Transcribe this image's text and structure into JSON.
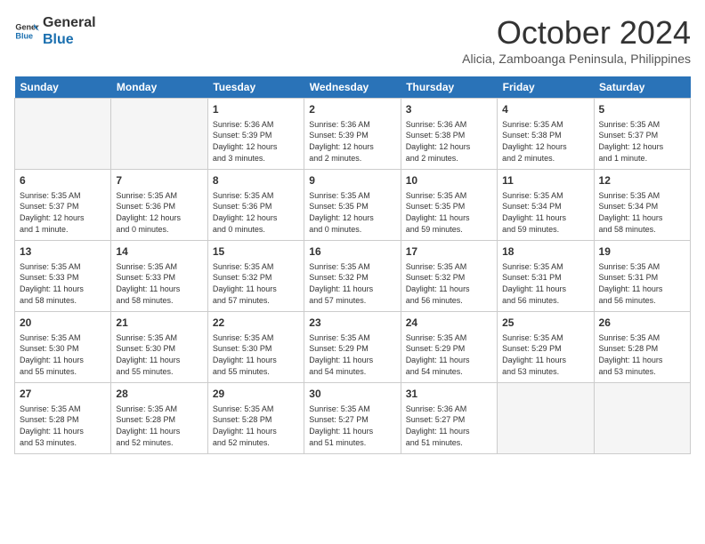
{
  "logo": {
    "line1": "General",
    "line2": "Blue"
  },
  "title": "October 2024",
  "subtitle": "Alicia, Zamboanga Peninsula, Philippines",
  "headers": [
    "Sunday",
    "Monday",
    "Tuesday",
    "Wednesday",
    "Thursday",
    "Friday",
    "Saturday"
  ],
  "weeks": [
    [
      {
        "day": "",
        "info": ""
      },
      {
        "day": "",
        "info": ""
      },
      {
        "day": "1",
        "info": "Sunrise: 5:36 AM\nSunset: 5:39 PM\nDaylight: 12 hours\nand 3 minutes."
      },
      {
        "day": "2",
        "info": "Sunrise: 5:36 AM\nSunset: 5:39 PM\nDaylight: 12 hours\nand 2 minutes."
      },
      {
        "day": "3",
        "info": "Sunrise: 5:36 AM\nSunset: 5:38 PM\nDaylight: 12 hours\nand 2 minutes."
      },
      {
        "day": "4",
        "info": "Sunrise: 5:35 AM\nSunset: 5:38 PM\nDaylight: 12 hours\nand 2 minutes."
      },
      {
        "day": "5",
        "info": "Sunrise: 5:35 AM\nSunset: 5:37 PM\nDaylight: 12 hours\nand 1 minute."
      }
    ],
    [
      {
        "day": "6",
        "info": "Sunrise: 5:35 AM\nSunset: 5:37 PM\nDaylight: 12 hours\nand 1 minute."
      },
      {
        "day": "7",
        "info": "Sunrise: 5:35 AM\nSunset: 5:36 PM\nDaylight: 12 hours\nand 0 minutes."
      },
      {
        "day": "8",
        "info": "Sunrise: 5:35 AM\nSunset: 5:36 PM\nDaylight: 12 hours\nand 0 minutes."
      },
      {
        "day": "9",
        "info": "Sunrise: 5:35 AM\nSunset: 5:35 PM\nDaylight: 12 hours\nand 0 minutes."
      },
      {
        "day": "10",
        "info": "Sunrise: 5:35 AM\nSunset: 5:35 PM\nDaylight: 11 hours\nand 59 minutes."
      },
      {
        "day": "11",
        "info": "Sunrise: 5:35 AM\nSunset: 5:34 PM\nDaylight: 11 hours\nand 59 minutes."
      },
      {
        "day": "12",
        "info": "Sunrise: 5:35 AM\nSunset: 5:34 PM\nDaylight: 11 hours\nand 58 minutes."
      }
    ],
    [
      {
        "day": "13",
        "info": "Sunrise: 5:35 AM\nSunset: 5:33 PM\nDaylight: 11 hours\nand 58 minutes."
      },
      {
        "day": "14",
        "info": "Sunrise: 5:35 AM\nSunset: 5:33 PM\nDaylight: 11 hours\nand 58 minutes."
      },
      {
        "day": "15",
        "info": "Sunrise: 5:35 AM\nSunset: 5:32 PM\nDaylight: 11 hours\nand 57 minutes."
      },
      {
        "day": "16",
        "info": "Sunrise: 5:35 AM\nSunset: 5:32 PM\nDaylight: 11 hours\nand 57 minutes."
      },
      {
        "day": "17",
        "info": "Sunrise: 5:35 AM\nSunset: 5:32 PM\nDaylight: 11 hours\nand 56 minutes."
      },
      {
        "day": "18",
        "info": "Sunrise: 5:35 AM\nSunset: 5:31 PM\nDaylight: 11 hours\nand 56 minutes."
      },
      {
        "day": "19",
        "info": "Sunrise: 5:35 AM\nSunset: 5:31 PM\nDaylight: 11 hours\nand 56 minutes."
      }
    ],
    [
      {
        "day": "20",
        "info": "Sunrise: 5:35 AM\nSunset: 5:30 PM\nDaylight: 11 hours\nand 55 minutes."
      },
      {
        "day": "21",
        "info": "Sunrise: 5:35 AM\nSunset: 5:30 PM\nDaylight: 11 hours\nand 55 minutes."
      },
      {
        "day": "22",
        "info": "Sunrise: 5:35 AM\nSunset: 5:30 PM\nDaylight: 11 hours\nand 55 minutes."
      },
      {
        "day": "23",
        "info": "Sunrise: 5:35 AM\nSunset: 5:29 PM\nDaylight: 11 hours\nand 54 minutes."
      },
      {
        "day": "24",
        "info": "Sunrise: 5:35 AM\nSunset: 5:29 PM\nDaylight: 11 hours\nand 54 minutes."
      },
      {
        "day": "25",
        "info": "Sunrise: 5:35 AM\nSunset: 5:29 PM\nDaylight: 11 hours\nand 53 minutes."
      },
      {
        "day": "26",
        "info": "Sunrise: 5:35 AM\nSunset: 5:28 PM\nDaylight: 11 hours\nand 53 minutes."
      }
    ],
    [
      {
        "day": "27",
        "info": "Sunrise: 5:35 AM\nSunset: 5:28 PM\nDaylight: 11 hours\nand 53 minutes."
      },
      {
        "day": "28",
        "info": "Sunrise: 5:35 AM\nSunset: 5:28 PM\nDaylight: 11 hours\nand 52 minutes."
      },
      {
        "day": "29",
        "info": "Sunrise: 5:35 AM\nSunset: 5:28 PM\nDaylight: 11 hours\nand 52 minutes."
      },
      {
        "day": "30",
        "info": "Sunrise: 5:35 AM\nSunset: 5:27 PM\nDaylight: 11 hours\nand 51 minutes."
      },
      {
        "day": "31",
        "info": "Sunrise: 5:36 AM\nSunset: 5:27 PM\nDaylight: 11 hours\nand 51 minutes."
      },
      {
        "day": "",
        "info": ""
      },
      {
        "day": "",
        "info": ""
      }
    ]
  ]
}
